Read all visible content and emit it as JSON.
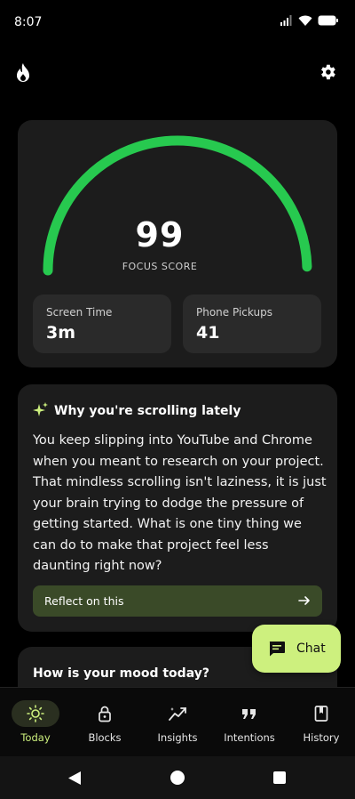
{
  "status": {
    "time": "8:07"
  },
  "score": {
    "value": "99",
    "label": "FOCUS SCORE",
    "gauge_fraction": 0.99,
    "color": "#27c94f"
  },
  "stats": [
    {
      "label": "Screen Time",
      "value": "3m"
    },
    {
      "label": "Phone Pickups",
      "value": "41"
    }
  ],
  "insight": {
    "title": "Why you're scrolling lately",
    "body": "You keep slipping into YouTube and Chrome when you meant to research on your project. That mindless scrolling isn't laziness, it is just your brain trying to dodge the pressure of getting started. What is one tiny thing we can do to make that project feel less daunting right now?",
    "cta": "Reflect on this"
  },
  "mood": {
    "title": "How is your mood today?"
  },
  "chat": {
    "label": "Chat",
    "color": "#cdf07e"
  },
  "nav": {
    "items": [
      {
        "label": "Today",
        "icon": "sun-icon",
        "active": true
      },
      {
        "label": "Blocks",
        "icon": "lock-icon",
        "active": false
      },
      {
        "label": "Insights",
        "icon": "trend-icon",
        "active": false
      },
      {
        "label": "Intentions",
        "icon": "quote-icon",
        "active": false
      },
      {
        "label": "History",
        "icon": "bookmark-icon",
        "active": false
      }
    ],
    "active_color": "#cdf07e"
  }
}
